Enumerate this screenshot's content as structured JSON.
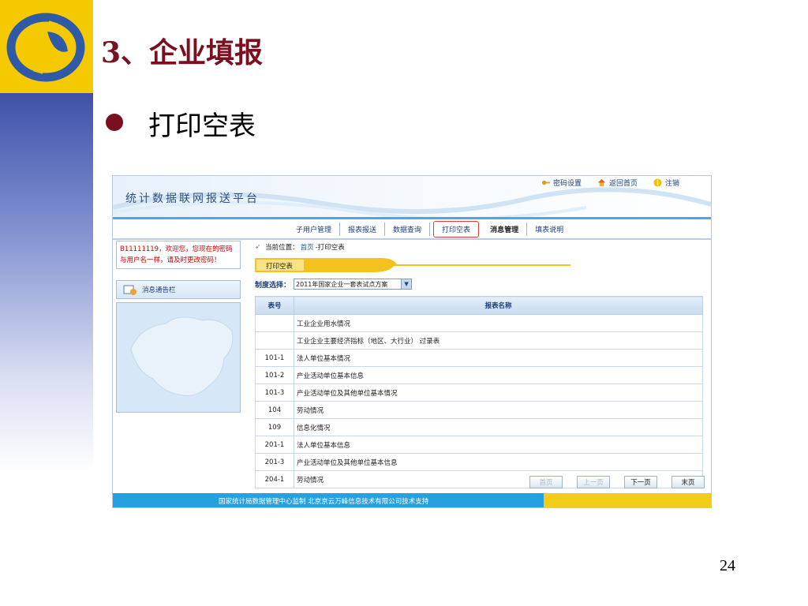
{
  "slide": {
    "title": "3、企业填报",
    "bullet": "打印空表",
    "page_number": "24"
  },
  "app": {
    "title": "统计数据联网报送平台",
    "top_links": [
      {
        "label": "密码设置",
        "icon": "key-icon"
      },
      {
        "label": "返回首页",
        "icon": "home-icon"
      },
      {
        "label": "注销",
        "icon": "info-icon"
      }
    ],
    "nav": [
      {
        "label": "子用户管理"
      },
      {
        "label": "报表报送"
      },
      {
        "label": "数据查询"
      },
      {
        "label": "打印空表"
      },
      {
        "label": "消息管理"
      },
      {
        "label": "填表说明"
      }
    ],
    "welcome": {
      "line1": "B11111119，欢迎您，您现在的密码",
      "line2": "与用户名一样，请及时更改密码！"
    },
    "notice_label": "消息通告栏",
    "breadcrumb": {
      "prefix": "当前位置：",
      "home": "首页",
      "current": "-打印空表"
    },
    "section_tab": "打印空表",
    "system_select": {
      "label": "制度选择：",
      "value": "2011年国家企业一套表试点方案"
    },
    "table": {
      "headers": [
        "表号",
        "报表名称"
      ],
      "rows": [
        {
          "code": "",
          "name": "工业企业用水情况"
        },
        {
          "code": "",
          "name": "工业企业主要经济指标（地区、大行业） 过录表"
        },
        {
          "code": "101-1",
          "name": "法人单位基本情况"
        },
        {
          "code": "101-2",
          "name": "产业活动单位基本信息"
        },
        {
          "code": "101-3",
          "name": "产业活动单位及其他单位基本情况"
        },
        {
          "code": "104",
          "name": "劳动情况"
        },
        {
          "code": "109",
          "name": "信息化情况"
        },
        {
          "code": "201-1",
          "name": "法人单位基本信息"
        },
        {
          "code": "201-3",
          "name": "产业活动单位及其他单位基本信息"
        },
        {
          "code": "204-1",
          "name": "劳动情况"
        }
      ]
    },
    "pager": [
      "首页",
      "上一页",
      "下一页",
      "末页"
    ],
    "footer": "国家统计局数据管理中心监制  北京京云万峰信息技术有限公司技术支持"
  },
  "colors": {
    "title_red": "#7a0f1f",
    "yellow": "#f5c900",
    "nav_blue": "#4fa6e0",
    "active_outline": "#e23b3b"
  }
}
